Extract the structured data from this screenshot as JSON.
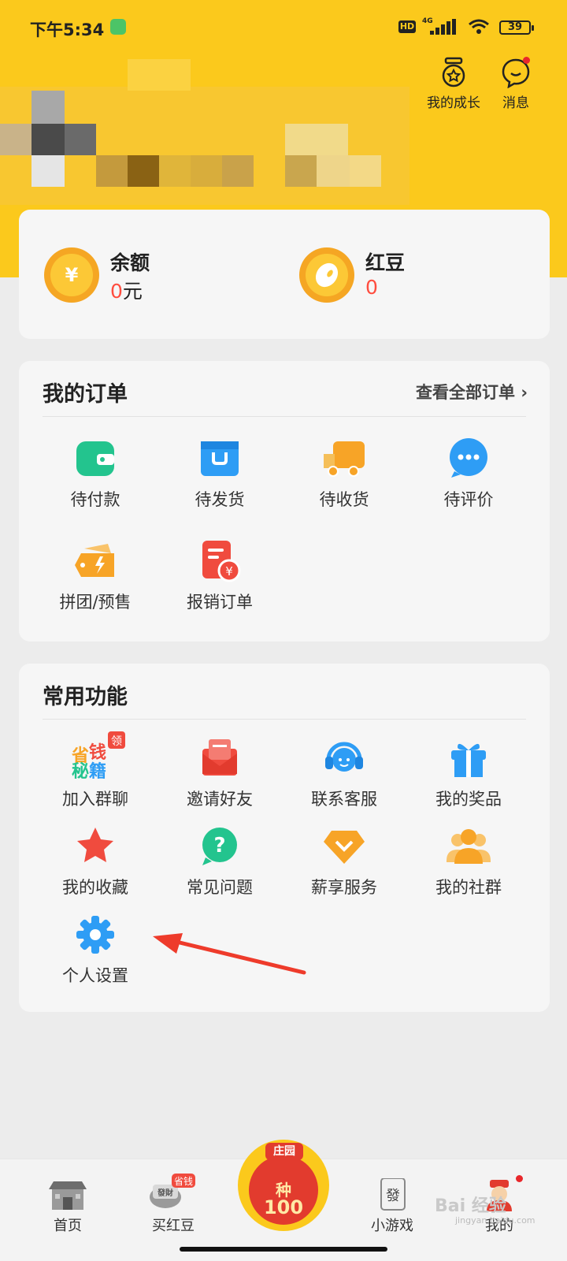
{
  "status_bar": {
    "time": "下午5:34",
    "hd": "HD",
    "network": "4G",
    "battery": "39"
  },
  "header": {
    "growth_label": "我的成长",
    "message_label": "消息"
  },
  "balance": {
    "left": {
      "label": "余额",
      "value": "0",
      "unit": "元",
      "icon": "yuan-coin-icon",
      "icon_text": "¥"
    },
    "right": {
      "label": "红豆",
      "value": "0",
      "icon": "red-bean-icon"
    }
  },
  "orders": {
    "title": "我的订单",
    "view_all": "查看全部订单 ›",
    "items": [
      {
        "label": "待付款",
        "icon": "wallet-icon"
      },
      {
        "label": "待发货",
        "icon": "package-icon"
      },
      {
        "label": "待收货",
        "icon": "truck-icon"
      },
      {
        "label": "待评价",
        "icon": "comment-icon"
      },
      {
        "label": "拼团/预售",
        "icon": "ticket-icon"
      },
      {
        "label": "报销订单",
        "icon": "receipt-icon"
      }
    ]
  },
  "functions": {
    "title": "常用功能",
    "items": [
      {
        "label": "加入群聊",
        "icon": "save-money-tips-icon",
        "badge": "领",
        "icon_text": [
          "省",
          "钱",
          "秘",
          "籍"
        ]
      },
      {
        "label": "邀请好友",
        "icon": "envelope-icon"
      },
      {
        "label": "联系客服",
        "icon": "headset-icon"
      },
      {
        "label": "我的奖品",
        "icon": "gift-icon"
      },
      {
        "label": "我的收藏",
        "icon": "star-icon"
      },
      {
        "label": "常见问题",
        "icon": "question-icon"
      },
      {
        "label": "薪享服务",
        "icon": "diamond-icon"
      },
      {
        "label": "我的社群",
        "icon": "group-icon"
      },
      {
        "label": "个人设置",
        "icon": "gear-icon"
      }
    ]
  },
  "tabbar": {
    "items": [
      {
        "label": "首页",
        "icon": "home-temple-icon"
      },
      {
        "label": "买红豆",
        "icon": "buy-bean-icon",
        "badge": "省钱",
        "icon_text": "發財"
      },
      {
        "label": "小游戏",
        "icon": "mahjong-icon",
        "icon_text": "發"
      },
      {
        "label": "我的",
        "icon": "profile-mascot-icon"
      }
    ],
    "center": {
      "label": "庄园",
      "line1": "种",
      "line2": "100",
      "icon": "farm-icon"
    }
  },
  "watermark": {
    "text": "Bai 经验",
    "sub": "jingyan.baidu.com"
  },
  "colors": {
    "brand_yellow": "#fbc91c",
    "accent_red": "#ff4d3f",
    "card_bg": "#f6f6f6",
    "page_bg": "#ececec"
  }
}
